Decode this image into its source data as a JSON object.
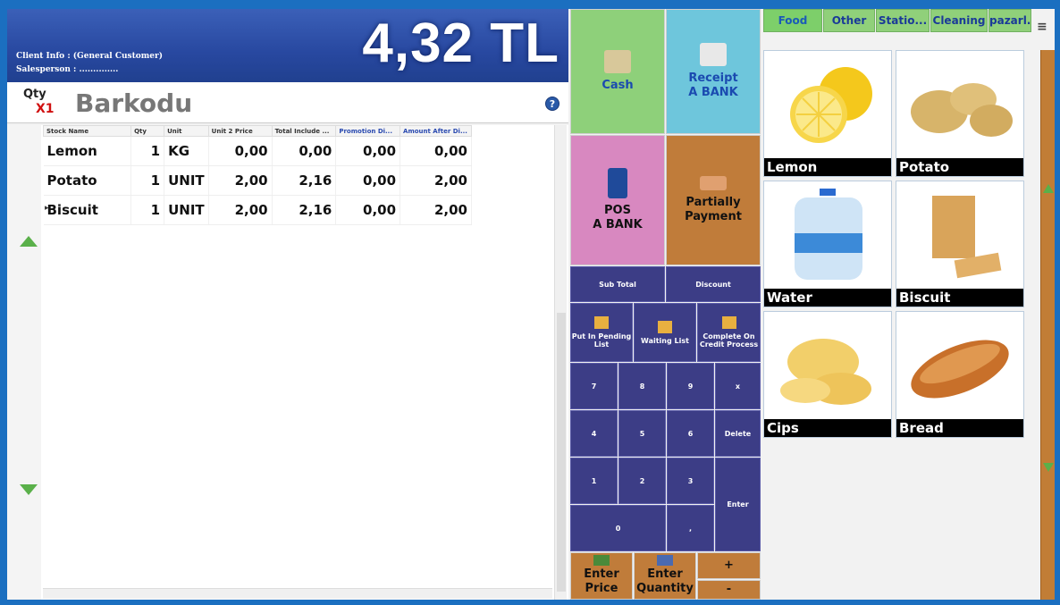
{
  "header": {
    "client_info": "Client Info : (General Customer)",
    "salesperson": "Salesperson : ..............",
    "total": "4,32 TL"
  },
  "barcode": {
    "qty_label": "Qty",
    "qty_multiplier": "X1",
    "placeholder": "Barkodu",
    "help_icon": "?"
  },
  "grid": {
    "columns": [
      "Stock Name",
      "Qty",
      "Unit",
      "Unit 2 Price",
      "Total Include ...",
      "Promotion Di...",
      "Amount After Di..."
    ],
    "rows": [
      {
        "name": "Lemon",
        "qty": "1",
        "unit": "KG",
        "unit_price": "0,00",
        "total": "0,00",
        "promo": "0,00",
        "amount": "0,00"
      },
      {
        "name": "Potato",
        "qty": "1",
        "unit": "UNIT",
        "unit_price": "2,00",
        "total": "2,16",
        "promo": "0,00",
        "amount": "2,00"
      },
      {
        "name": "Biscuit",
        "qty": "1",
        "unit": "UNIT",
        "unit_price": "2,00",
        "total": "2,16",
        "promo": "0,00",
        "amount": "2,00"
      }
    ]
  },
  "payment": {
    "cash": "Cash",
    "receipt_l1": "Receipt",
    "receipt_l2": "A BANK",
    "pos_l1": "POS",
    "pos_l2": "A BANK",
    "partial_l1": "Partially",
    "partial_l2": "Payment"
  },
  "actions": {
    "sub_total": "Sub Total",
    "discount": "Discount",
    "pending": "Put In Pending List",
    "waiting": "Waiting List",
    "credit": "Complete On Credit Process"
  },
  "keypad": {
    "k7": "7",
    "k8": "8",
    "k9": "9",
    "kx": "x",
    "k4": "4",
    "k5": "5",
    "k6": "6",
    "delete": "Delete",
    "k1": "1",
    "k2": "2",
    "k3": "3",
    "enter": "Enter",
    "k0": "0",
    "dot": ","
  },
  "bottom": {
    "enter_price_l1": "Enter",
    "enter_price_l2": "Price",
    "enter_qty_l1": "Enter",
    "enter_qty_l2": "Quantity",
    "plus": "+",
    "minus": "-"
  },
  "tabs": [
    "Food",
    "Other",
    "Statio...",
    "Cleaning",
    "pazarl..."
  ],
  "menu_icon": "≡",
  "products": [
    {
      "name": "Lemon"
    },
    {
      "name": "Potato"
    },
    {
      "name": "Water"
    },
    {
      "name": "Biscuit"
    },
    {
      "name": "Cips"
    },
    {
      "name": "Bread"
    }
  ],
  "colors": {
    "header_blue": "#2848a0",
    "cash_green": "#8ed07a",
    "receipt_cyan": "#6ec6dc",
    "pos_pink": "#d888c0",
    "partial_orange": "#c07c3a",
    "keypad_navy": "#3c3d86"
  }
}
